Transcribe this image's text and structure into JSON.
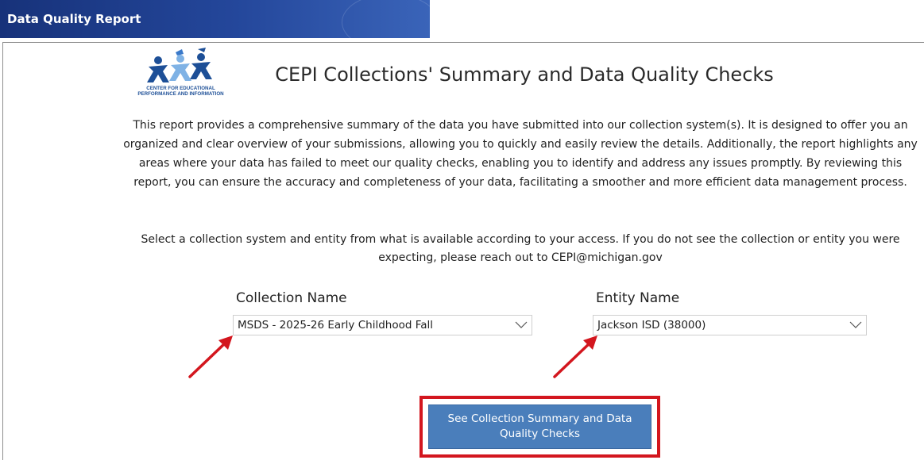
{
  "header": {
    "title": "Data Quality Report"
  },
  "logo": {
    "line1": "CENTER FOR EDUCATIONAL",
    "line2": "PERFORMANCE AND INFORMATION"
  },
  "page": {
    "heading": "CEPI Collections' Summary and Data Quality Checks",
    "intro": "This report provides a comprehensive summary of the data you have submitted into our collection system(s). It is designed to offer you an organized and clear overview of your submissions, allowing you to quickly and easily review the details. Additionally, the report highlights any areas where your data has failed to meet our quality checks, enabling you to identify and address any issues promptly. By reviewing this report, you can ensure the accuracy and completeness of your data, facilitating a smoother and more efficient data management process.",
    "select_note": "Select a collection system and entity from what is available according to your access. If you do not see the collection or entity you were expecting, please reach out to CEPI@michigan.gov"
  },
  "filters": {
    "collection": {
      "label": "Collection Name",
      "value": "MSDS - 2025-26 Early Childhood Fall"
    },
    "entity": {
      "label": "Entity Name",
      "value": "Jackson ISD (38000)"
    }
  },
  "action": {
    "button_label": "See Collection Summary and Data Quality Checks"
  },
  "colors": {
    "header_bg": "#24479b",
    "button_bg": "#4a7ebb",
    "highlight": "#d3161e",
    "annotation_arrow": "#d3161e"
  },
  "icons": [
    "chevron-down-icon",
    "cepi-logo",
    "annotation-arrow"
  ]
}
